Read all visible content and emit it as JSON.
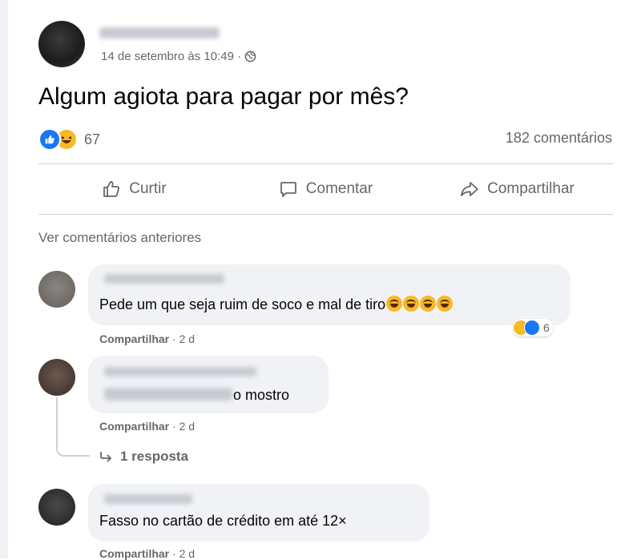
{
  "post": {
    "timestamp": "14 de setembro às 10:49 ·",
    "text": "Algum agiota para pagar por mês?",
    "reaction_count": "67",
    "comments_count": "182 comentários",
    "reactions": [
      "like-reaction-icon",
      "haha-reaction-icon"
    ]
  },
  "actions": {
    "like": "Curtir",
    "comment": "Comentar",
    "share": "Compartilhar"
  },
  "view_previous": "Ver comentários anteriores",
  "comments": [
    {
      "text": "Pede um que seja ruim de soco e mal de tiro",
      "emoji_count": 4,
      "action": "Compartilhar",
      "age": "· 2 d",
      "reaction_count": "6"
    },
    {
      "text": "o mostro",
      "action": "Compartilhar",
      "age": "· 2 d",
      "replies": "1 resposta"
    },
    {
      "text": "Fasso no cartão de crédito em até 12×",
      "action": "Compartilhar",
      "age": "· 2 d"
    }
  ],
  "colors": {
    "facebook_blue": "#1877f2",
    "haha_yellow": "#f7b928",
    "secondary_text": "#65676b",
    "bubble_bg": "#f0f2f5"
  }
}
